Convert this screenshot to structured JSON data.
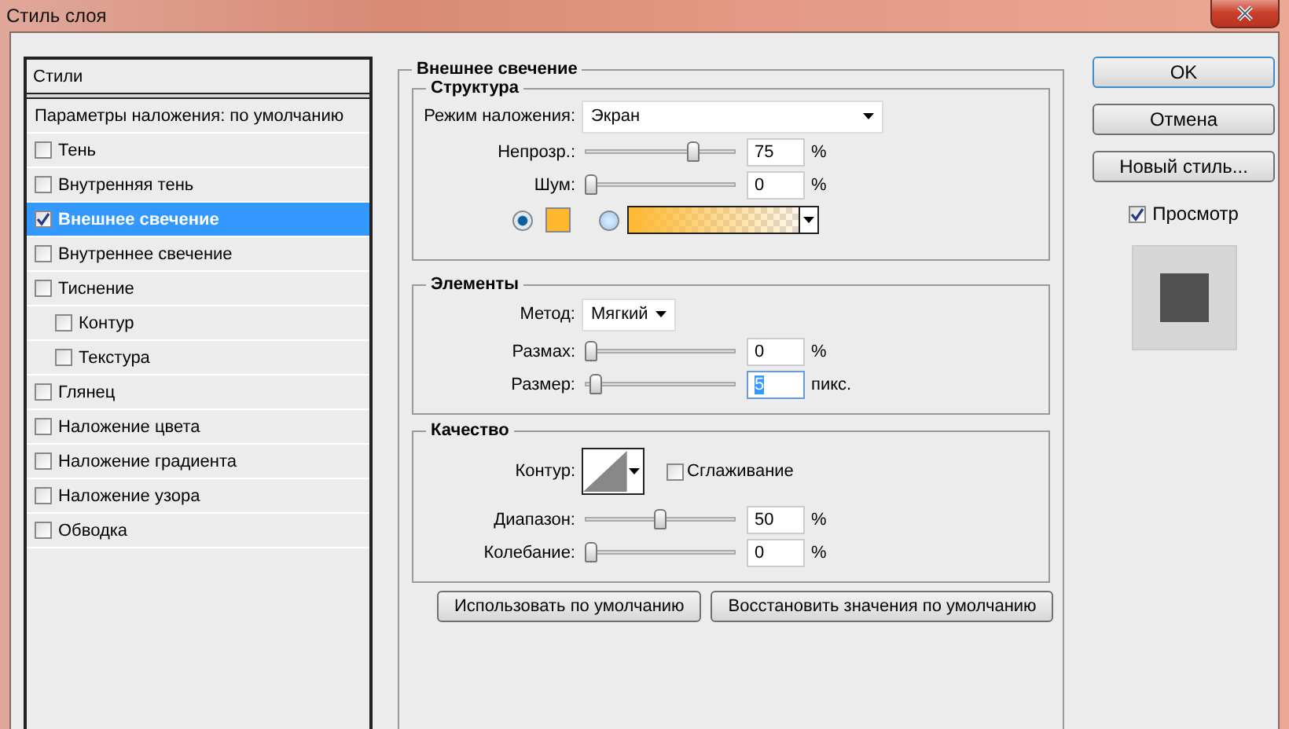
{
  "window": {
    "title": "Стиль слоя"
  },
  "styles_panel": {
    "header": "Стили",
    "blending": "Параметры наложения: по умолчанию",
    "items": [
      {
        "label": "Тень",
        "checked": false,
        "selected": false
      },
      {
        "label": "Внутренняя тень",
        "checked": false,
        "selected": false
      },
      {
        "label": "Внешнее свечение",
        "checked": true,
        "selected": true
      },
      {
        "label": "Внутреннее свечение",
        "checked": false,
        "selected": false
      },
      {
        "label": "Тиснение",
        "checked": false,
        "selected": false,
        "children": [
          {
            "label": "Контур",
            "checked": false,
            "selected": false
          },
          {
            "label": "Текстура",
            "checked": false,
            "selected": false
          }
        ]
      },
      {
        "label": "Глянец",
        "checked": false,
        "selected": false
      },
      {
        "label": "Наложение цвета",
        "checked": false,
        "selected": false
      },
      {
        "label": "Наложение градиента",
        "checked": false,
        "selected": false
      },
      {
        "label": "Наложение узора",
        "checked": false,
        "selected": false
      },
      {
        "label": "Обводка",
        "checked": false,
        "selected": false
      }
    ]
  },
  "outer_glow": {
    "title": "Внешнее свечение",
    "structure": {
      "title": "Структура",
      "blend_mode": {
        "label": "Режим наложения:",
        "value": "Экран"
      },
      "sliders": [
        {
          "label": "Непрозр.:",
          "level": 0.75,
          "value": "75",
          "unit": "%"
        },
        {
          "label": "Шум:",
          "level": 0,
          "value": "0",
          "unit": "%"
        }
      ],
      "fill": {
        "color_selected": true,
        "gradient_selected": false,
        "color": "#ffb830"
      }
    },
    "elements": {
      "title": "Элементы",
      "method": {
        "label": "Метод:",
        "value": "Мягкий"
      },
      "sliders": [
        {
          "label": "Размах:",
          "level": 0,
          "value": "0",
          "unit": "%"
        },
        {
          "label": "Размер:",
          "level": 0.03,
          "value": "5",
          "unit": "пикс.",
          "focused": true
        }
      ]
    },
    "quality": {
      "title": "Качество",
      "contour": {
        "label": "Контур:"
      },
      "antialias": {
        "label": "Сглаживание",
        "checked": false
      },
      "sliders": [
        {
          "label": "Диапазон:",
          "level": 0.5,
          "value": "50",
          "unit": "%"
        },
        {
          "label": "Колебание:",
          "level": 0,
          "value": "0",
          "unit": "%"
        }
      ]
    },
    "buttons": [
      "Использовать по умолчанию",
      "Восстановить значения по умолчанию"
    ]
  },
  "actions": [
    {
      "label": "OK",
      "default": true
    },
    {
      "label": "Отмена",
      "default": false
    },
    {
      "label": "Новый стиль...",
      "default": false
    }
  ],
  "preview": {
    "label": "Просмотр",
    "checked": true
  }
}
